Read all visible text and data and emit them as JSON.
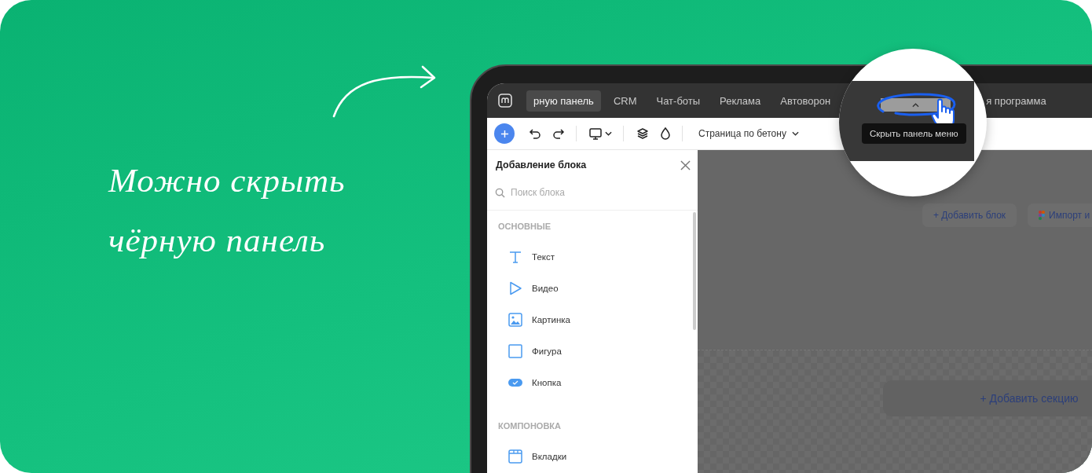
{
  "headline": "Можно скрыть чёрную панель",
  "top_bar": {
    "tabs": [
      {
        "label": "рную панель",
        "selected": true
      },
      {
        "label": "CRM",
        "selected": false
      },
      {
        "label": "Чат-боты",
        "selected": false
      },
      {
        "label": "Реклама",
        "selected": false
      },
      {
        "label": "Автоворон",
        "selected": false
      }
    ],
    "trailing_tab": {
      "label": "я программа",
      "selected": false
    }
  },
  "toolbar": {
    "page_selector": "Страница по бетону"
  },
  "sidebar": {
    "title": "Добавление блока",
    "search": {
      "placeholder": "Поиск блока"
    },
    "sections": [
      {
        "heading": "ОСНОВНЫЕ",
        "items": [
          {
            "label": "Текст",
            "kind": "text"
          },
          {
            "label": "Видео",
            "kind": "video"
          },
          {
            "label": "Картинка",
            "kind": "image"
          },
          {
            "label": "Фигура",
            "kind": "shape"
          },
          {
            "label": "Кнопка",
            "kind": "button"
          }
        ]
      },
      {
        "heading": "КОМПОНОВКА",
        "items": [
          {
            "label": "Вкладки",
            "kind": "tabs"
          }
        ]
      }
    ]
  },
  "canvas": {
    "add_block": "+ Добавить блок",
    "import": "Импорт и",
    "add_section": "+ Добавить секцию"
  },
  "magnifier": {
    "tooltip": "Скрыть панель меню"
  }
}
